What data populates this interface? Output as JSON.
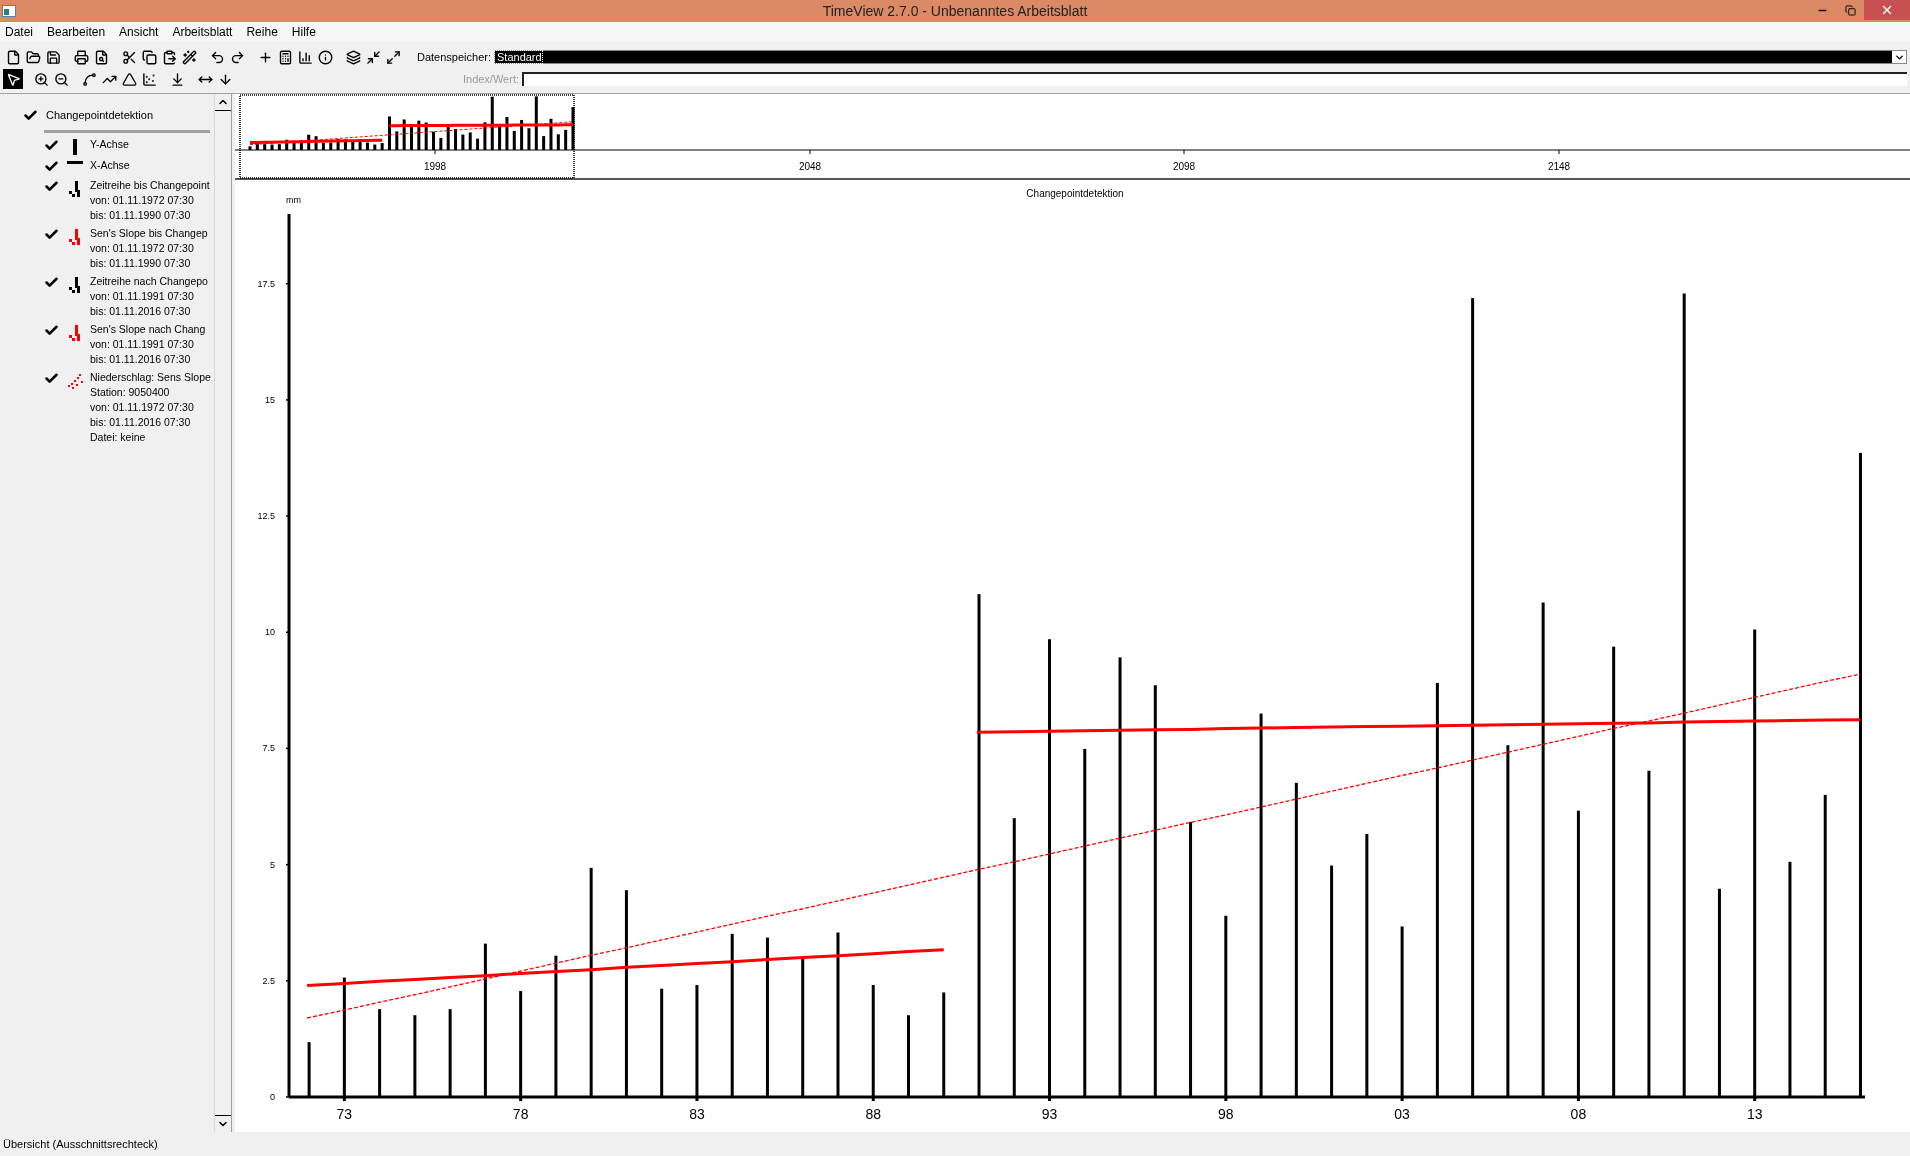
{
  "window": {
    "title": "TimeView 2.7.0  - Unbenanntes Arbeitsblatt"
  },
  "menu": [
    "Datei",
    "Bearbeiten",
    "Ansicht",
    "Arbeitsblatt",
    "Reihe",
    "Hilfe"
  ],
  "toolbar_rows": [
    {
      "buttons": [
        {
          "selected": false
        },
        {
          "selected": false
        },
        {
          "selected": false
        },
        {
          "selected": false
        },
        {
          "selected": false
        },
        {
          "selected": false
        },
        {
          "selected": false
        },
        {
          "selected": false
        },
        {
          "selected": false
        },
        {
          "selected": false
        },
        {
          "selected": false
        },
        {
          "selected": false
        },
        {
          "selected": false
        },
        {
          "selected": false
        },
        {
          "selected": false
        },
        {
          "selected": false
        },
        {
          "selected": false
        },
        {
          "selected": false
        }
      ]
    },
    {
      "buttons": [
        {
          "selected": true
        },
        {
          "selected": false
        },
        {
          "selected": false
        },
        {
          "selected": false
        },
        {
          "selected": false
        },
        {
          "selected": false
        },
        {
          "selected": false
        },
        {
          "selected": false
        },
        {
          "selected": false
        },
        {
          "selected": false
        }
      ]
    }
  ],
  "storage": {
    "label": "Datenspeicher:",
    "value": "Standard"
  },
  "index_field": {
    "label": "Index/Wert:",
    "disabled": true
  },
  "tree": {
    "label": "Changepointdetektion",
    "checked": true,
    "children": [
      {
        "kind": "y-axis",
        "checked": true,
        "color": "#000000",
        "lines": [
          "Y-Achse"
        ]
      },
      {
        "kind": "x-axis",
        "checked": true,
        "color": "#000000",
        "lines": [
          "X-Achse"
        ]
      },
      {
        "kind": "series",
        "checked": true,
        "color": "#000000",
        "lines": [
          "Zeitreihe bis Changepoint",
          "von: 01.11.1972 07:30",
          "bis: 01.11.1990 07:30"
        ]
      },
      {
        "kind": "series",
        "checked": true,
        "color": "#ff0000",
        "lines": [
          "Sen's Slope bis Changep",
          "von: 01.11.1972 07:30",
          "bis: 01.11.1990 07:30"
        ]
      },
      {
        "kind": "series",
        "checked": true,
        "color": "#000000",
        "lines": [
          "Zeitreihe nach Changepo",
          "von: 01.11.1991 07:30",
          "bis: 01.11.2016 07:30"
        ]
      },
      {
        "kind": "series",
        "checked": true,
        "color": "#ff0000",
        "lines": [
          "Sen's Slope nach Chang",
          "von: 01.11.1991 07:30",
          "bis: 01.11.2016 07:30"
        ]
      },
      {
        "kind": "trend",
        "checked": true,
        "color": "#ff0000",
        "lines": [
          "Niederschlag: Sens Slope",
          "Station: 9050400",
          "von: 01.11.1972 07:30",
          "bis: 01.11.2016 07:30",
          "Datei: keine"
        ]
      }
    ]
  },
  "overview": {
    "ticks": [
      "1998",
      "2048",
      "2098",
      "2148"
    ]
  },
  "chart": {
    "chart_data": {
      "type": "bar",
      "title": "Changepointdetektion",
      "ylabel": "mm",
      "x": [
        1972,
        1973,
        1974,
        1975,
        1976,
        1977,
        1978,
        1979,
        1980,
        1981,
        1982,
        1983,
        1984,
        1985,
        1986,
        1987,
        1988,
        1989,
        1990,
        1991,
        1992,
        1993,
        1994,
        1995,
        1996,
        1997,
        1998,
        1999,
        2000,
        2001,
        2002,
        2003,
        2004,
        2005,
        2006,
        2007,
        2008,
        2009,
        2010,
        2011,
        2012,
        2013,
        2014,
        2015,
        2016
      ],
      "xlim": [
        1971.43,
        2016.1
      ],
      "ylim": [
        0,
        19
      ],
      "xticks": [
        {
          "value": 1973,
          "label": "73"
        },
        {
          "value": 1978,
          "label": "78"
        },
        {
          "value": 1983,
          "label": "83"
        },
        {
          "value": 1988,
          "label": "88"
        },
        {
          "value": 1993,
          "label": "93"
        },
        {
          "value": 1998,
          "label": "98"
        },
        {
          "value": 2003,
          "label": "03"
        },
        {
          "value": 2008,
          "label": "08"
        },
        {
          "value": 2013,
          "label": "13"
        }
      ],
      "yticks": [
        {
          "value": 0,
          "label": "0"
        },
        {
          "value": 2.5,
          "label": "2.5"
        },
        {
          "value": 5,
          "label": "5"
        },
        {
          "value": 7.5,
          "label": "7.5"
        },
        {
          "value": 10,
          "label": "10"
        },
        {
          "value": 12.5,
          "label": "12.5"
        },
        {
          "value": 15,
          "label": "15"
        },
        {
          "value": 17.5,
          "label": "17.5"
        }
      ],
      "series": [
        {
          "type": "bar",
          "color": "#000000",
          "values": [
            1.18,
            2.57,
            1.89,
            1.76,
            1.89,
            3.3,
            2.28,
            3.04,
            4.93,
            4.45,
            2.33,
            2.41,
            3.51,
            3.43,
            2.99,
            3.54,
            2.41,
            1.76,
            2.25,
            null,
            null,
            null,
            null,
            null,
            null,
            null,
            null,
            null,
            null,
            null,
            null,
            null,
            null,
            null,
            null,
            null,
            null,
            null,
            null,
            null,
            null,
            null,
            null,
            null,
            null
          ]
        },
        {
          "type": "line",
          "line_style": "solid",
          "color": "#ff0000",
          "values": [
            2.4,
            2.44,
            2.49,
            2.53,
            2.57,
            2.61,
            2.66,
            2.7,
            2.74,
            2.79,
            2.83,
            2.87,
            2.91,
            2.96,
            3.0,
            3.04,
            3.08,
            3.13,
            3.17,
            null,
            null,
            null,
            null,
            null,
            null,
            null,
            null,
            null,
            null,
            null,
            null,
            null,
            null,
            null,
            null,
            null,
            null,
            null,
            null,
            null,
            null,
            null,
            null,
            null,
            null
          ]
        },
        {
          "type": "bar",
          "color": "#000000",
          "values": [
            null,
            null,
            null,
            null,
            null,
            null,
            null,
            null,
            null,
            null,
            null,
            null,
            null,
            null,
            null,
            null,
            null,
            null,
            null,
            10.82,
            6.0,
            9.85,
            7.49,
            9.46,
            8.86,
            5.92,
            3.9,
            8.25,
            6.76,
            4.98,
            5.66,
            3.67,
            8.91,
            17.19,
            7.57,
            10.64,
            6.16,
            9.69,
            7.02,
            17.29,
            4.48,
            10.06,
            5.06,
            6.5,
            13.86
          ]
        },
        {
          "type": "line",
          "line_style": "solid",
          "color": "#ff0000",
          "values": [
            null,
            null,
            null,
            null,
            null,
            null,
            null,
            null,
            null,
            null,
            null,
            null,
            null,
            null,
            null,
            null,
            null,
            null,
            null,
            7.85,
            7.86,
            7.87,
            7.88,
            7.89,
            7.9,
            7.91,
            7.93,
            7.94,
            7.95,
            7.96,
            7.97,
            7.98,
            7.99,
            8.0,
            8.01,
            8.02,
            8.03,
            8.04,
            8.05,
            8.07,
            8.08,
            8.09,
            8.1,
            8.11,
            8.12
          ]
        },
        {
          "type": "line",
          "line_style": "dashed",
          "color": "#ff0000",
          "values": [
            1.7,
            1.87,
            2.04,
            2.2,
            2.37,
            2.54,
            2.71,
            2.88,
            3.05,
            3.21,
            3.38,
            3.55,
            3.72,
            3.89,
            4.05,
            4.22,
            4.39,
            4.56,
            4.73,
            4.9,
            5.06,
            5.23,
            5.4,
            5.57,
            5.74,
            5.91,
            6.07,
            6.24,
            6.41,
            6.58,
            6.75,
            6.92,
            7.08,
            7.25,
            7.42,
            7.59,
            7.76,
            7.93,
            8.09,
            8.26,
            8.43,
            8.6,
            8.77,
            8.94,
            9.1
          ]
        }
      ]
    }
  },
  "status_bar": "Übersicht (Ausschnittsrechteck)"
}
